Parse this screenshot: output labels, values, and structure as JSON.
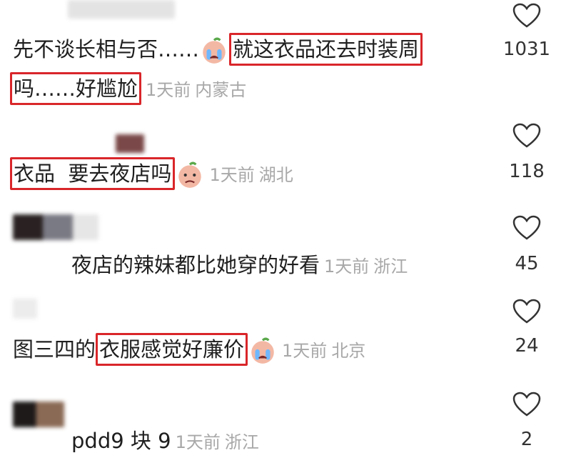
{
  "comments": [
    {
      "text_before": "先不谈长相与否……",
      "highlight": "就这衣品还去时装周",
      "line2_highlight": "吗……好尴尬",
      "time": "1天前",
      "location": "内蒙古",
      "likes": "1031",
      "emoji": "crying-face-emoji"
    },
    {
      "highlight": "衣品  要去夜店吗",
      "time": "1天前",
      "location": "湖北",
      "likes": "118",
      "emoji": "sad-face-emoji"
    },
    {
      "text": "夜店的辣妹都比她穿的好看",
      "time": "1天前",
      "location": "浙江",
      "likes": "45"
    },
    {
      "text_before": "图三四的",
      "highlight": "衣服感觉好廉价",
      "time": "1天前",
      "location": "北京",
      "likes": "24",
      "emoji": "crying-face-emoji"
    },
    {
      "text": "pdd9 块 9",
      "time": "1天前",
      "location": "浙江",
      "likes": "2"
    }
  ],
  "colors": {
    "highlight_border": "#d9262a",
    "meta_text": "#a8a8a8",
    "body_text": "#1f1f1f"
  },
  "icons": {
    "like": "heart-outline-icon"
  }
}
